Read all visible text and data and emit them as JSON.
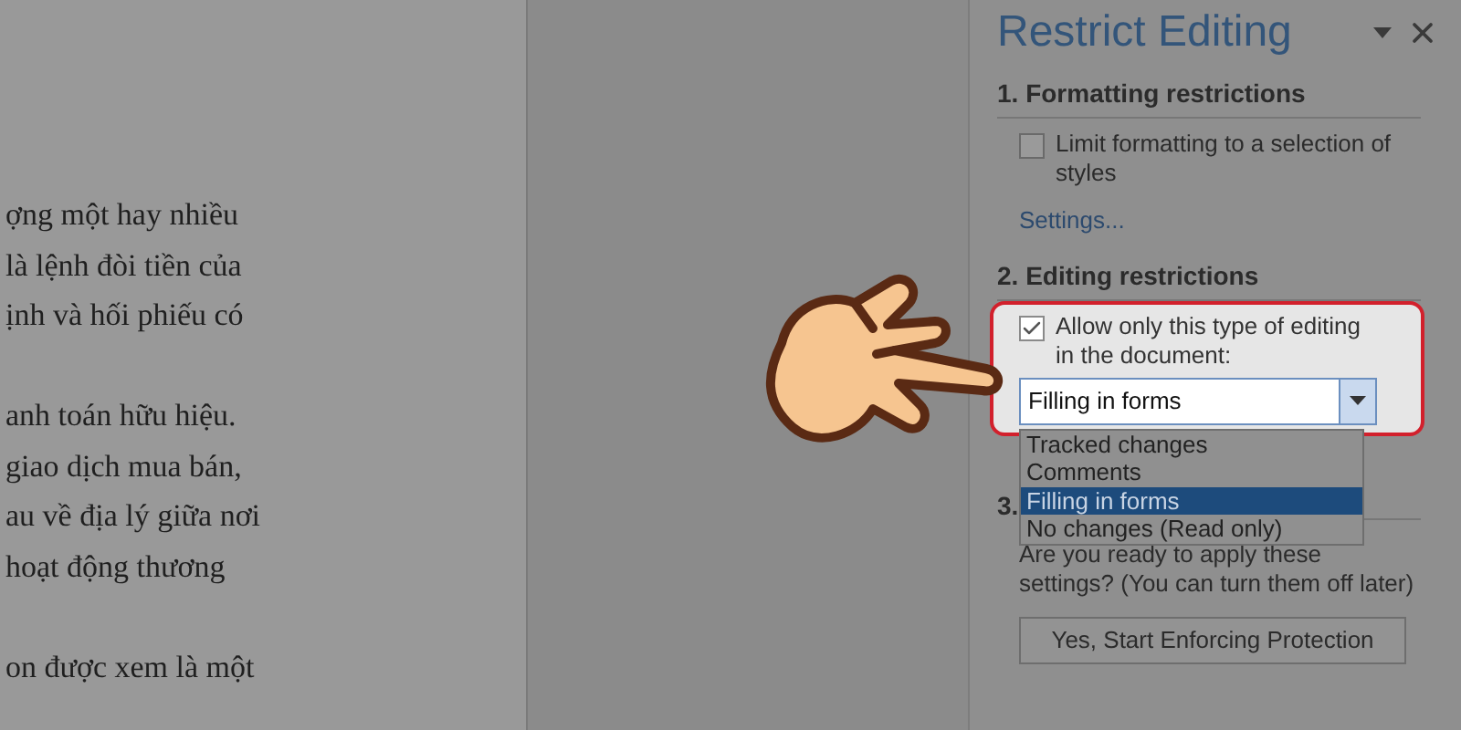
{
  "document": {
    "paragraphs": [
      [
        "ợng một hay nhiều",
        "là lệnh đòi tiền của",
        "ịnh và hối phiếu có"
      ],
      [
        "anh toán hữu hiệu.",
        "giao dịch mua bán,",
        "au về địa lý giữa nơi",
        "hoạt động thương"
      ],
      [
        "on được xem là một"
      ]
    ]
  },
  "pane": {
    "title": "Restrict Editing"
  },
  "formatting": {
    "heading": "1. Formatting restrictions",
    "checkbox": {
      "label": "Limit formatting to a selection of styles",
      "checked": false
    },
    "link": "Settings..."
  },
  "editing": {
    "heading": "2. Editing restrictions",
    "checkbox": {
      "label": "Allow only this type of editing in the document:",
      "checked": true
    },
    "dropdown": {
      "value": "Filling in forms",
      "options": [
        {
          "label": "Tracked changes",
          "selected": false
        },
        {
          "label": "Comments",
          "selected": false
        },
        {
          "label": "Filling in forms",
          "selected": true
        },
        {
          "label": "No changes (Read only)",
          "selected": false
        }
      ]
    }
  },
  "enforcement": {
    "heading": "3.",
    "text": "Are you ready to apply these settings? (You can turn them off later)",
    "button": "Yes, Start Enforcing Protection"
  }
}
